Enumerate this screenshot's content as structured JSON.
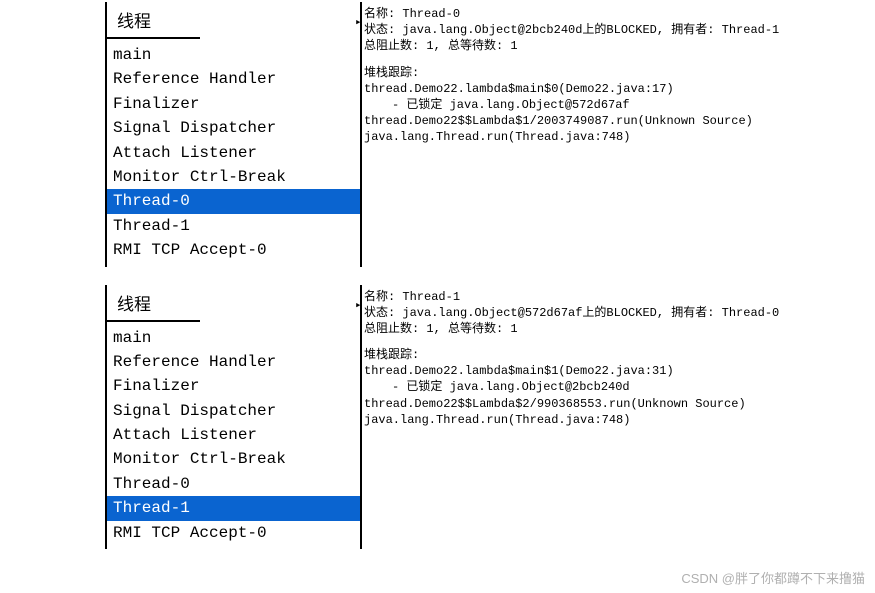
{
  "panel1": {
    "tab": "线程",
    "threads": [
      "main",
      "Reference Handler",
      "Finalizer",
      "Signal Dispatcher",
      "Attach Listener",
      "Monitor Ctrl-Break",
      "Thread-0",
      "Thread-1",
      "RMI TCP Accept-0"
    ],
    "selected_index": 6,
    "details": {
      "name_label": "名称:",
      "name_value": "Thread-0",
      "state_label": "状态:",
      "state_value": "java.lang.Object@2bcb240d上的BLOCKED, 拥有者: Thread-1",
      "blocked_label": "总阻止数:",
      "blocked_value": "1,",
      "waited_label": "总等待数:",
      "waited_value": "1",
      "stack_title": "堆栈跟踪:",
      "stack_lines": [
        {
          "text": "thread.Demo22.lambda$main$0(Demo22.java:17)",
          "indent": false
        },
        {
          "text": "- 已锁定 java.lang.Object@572d67af",
          "indent": true
        },
        {
          "text": "thread.Demo22$$Lambda$1/2003749087.run(Unknown Source)",
          "indent": false
        },
        {
          "text": "java.lang.Thread.run(Thread.java:748)",
          "indent": false
        }
      ]
    }
  },
  "panel2": {
    "tab": "线程",
    "threads": [
      "main",
      "Reference Handler",
      "Finalizer",
      "Signal Dispatcher",
      "Attach Listener",
      "Monitor Ctrl-Break",
      "Thread-0",
      "Thread-1",
      "RMI TCP Accept-0"
    ],
    "selected_index": 7,
    "details": {
      "name_label": "名称:",
      "name_value": "Thread-1",
      "state_label": "状态:",
      "state_value": "java.lang.Object@572d67af上的BLOCKED, 拥有者: Thread-0",
      "blocked_label": "总阻止数:",
      "blocked_value": "1,",
      "waited_label": "总等待数:",
      "waited_value": "1",
      "stack_title": "堆栈跟踪:",
      "stack_lines": [
        {
          "text": "thread.Demo22.lambda$main$1(Demo22.java:31)",
          "indent": false
        },
        {
          "text": "- 已锁定 java.lang.Object@2bcb240d",
          "indent": true
        },
        {
          "text": "thread.Demo22$$Lambda$2/990368553.run(Unknown Source)",
          "indent": false
        },
        {
          "text": "java.lang.Thread.run(Thread.java:748)",
          "indent": false
        }
      ]
    }
  },
  "watermark": "CSDN @胖了你都蹲不下来撸猫"
}
